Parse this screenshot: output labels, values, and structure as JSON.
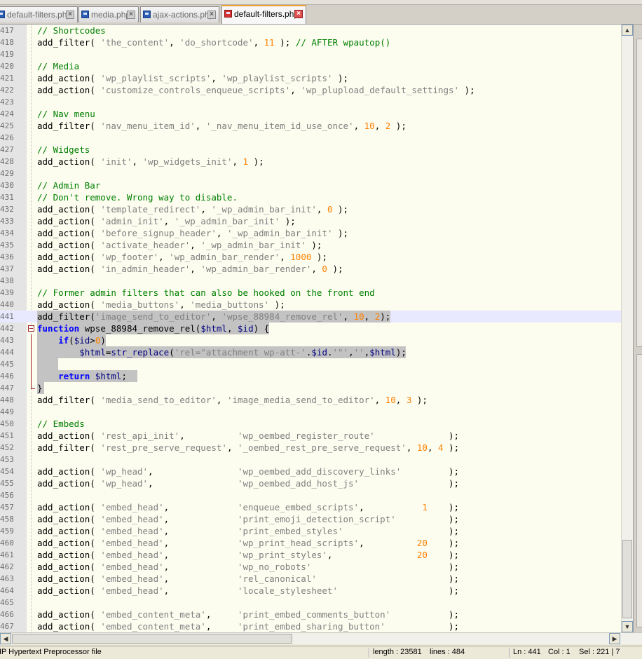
{
  "tabs": [
    {
      "label": "default-filters.php",
      "active": false
    },
    {
      "label": "media.php",
      "active": false
    },
    {
      "label": "ajax-actions.php",
      "active": false
    },
    {
      "label": "default-filters.php",
      "active": true
    }
  ],
  "editor": {
    "current_line": "441",
    "lines": [
      {
        "num": "417",
        "code": [
          {
            "t": "// Shortcodes",
            "c": "c"
          }
        ]
      },
      {
        "num": "418",
        "code": [
          {
            "t": "add_filter( "
          },
          {
            "t": "'the_content'",
            "c": "s"
          },
          {
            "t": ", "
          },
          {
            "t": "'do_shortcode'",
            "c": "s"
          },
          {
            "t": ", "
          },
          {
            "t": "11",
            "c": "n"
          },
          {
            "t": " ); "
          },
          {
            "t": "// AFTER wpautop()",
            "c": "c"
          }
        ]
      },
      {
        "num": "419",
        "code": []
      },
      {
        "num": "420",
        "code": [
          {
            "t": "// Media",
            "c": "c"
          }
        ]
      },
      {
        "num": "421",
        "code": [
          {
            "t": "add_action( "
          },
          {
            "t": "'wp_playlist_scripts'",
            "c": "s"
          },
          {
            "t": ", "
          },
          {
            "t": "'wp_playlist_scripts'",
            "c": "s"
          },
          {
            "t": " );"
          }
        ]
      },
      {
        "num": "422",
        "code": [
          {
            "t": "add_action( "
          },
          {
            "t": "'customize_controls_enqueue_scripts'",
            "c": "s"
          },
          {
            "t": ", "
          },
          {
            "t": "'wp_plupload_default_settings'",
            "c": "s"
          },
          {
            "t": " );"
          }
        ]
      },
      {
        "num": "423",
        "code": []
      },
      {
        "num": "424",
        "code": [
          {
            "t": "// Nav menu",
            "c": "c"
          }
        ]
      },
      {
        "num": "425",
        "code": [
          {
            "t": "add_filter( "
          },
          {
            "t": "'nav_menu_item_id'",
            "c": "s"
          },
          {
            "t": ", "
          },
          {
            "t": "'_nav_menu_item_id_use_once'",
            "c": "s"
          },
          {
            "t": ", "
          },
          {
            "t": "10",
            "c": "n"
          },
          {
            "t": ", "
          },
          {
            "t": "2",
            "c": "n"
          },
          {
            "t": " );"
          }
        ]
      },
      {
        "num": "426",
        "code": []
      },
      {
        "num": "427",
        "code": [
          {
            "t": "// Widgets",
            "c": "c"
          }
        ]
      },
      {
        "num": "428",
        "code": [
          {
            "t": "add_action( "
          },
          {
            "t": "'init'",
            "c": "s"
          },
          {
            "t": ", "
          },
          {
            "t": "'wp_widgets_init'",
            "c": "s"
          },
          {
            "t": ", "
          },
          {
            "t": "1",
            "c": "n"
          },
          {
            "t": " );"
          }
        ]
      },
      {
        "num": "429",
        "code": []
      },
      {
        "num": "430",
        "code": [
          {
            "t": "// Admin Bar",
            "c": "c"
          }
        ]
      },
      {
        "num": "431",
        "code": [
          {
            "t": "// Don't remove. Wrong way to disable.",
            "c": "c"
          }
        ]
      },
      {
        "num": "432",
        "code": [
          {
            "t": "add_action( "
          },
          {
            "t": "'template_redirect'",
            "c": "s"
          },
          {
            "t": ", "
          },
          {
            "t": "'_wp_admin_bar_init'",
            "c": "s"
          },
          {
            "t": ", "
          },
          {
            "t": "0",
            "c": "n"
          },
          {
            "t": " );"
          }
        ]
      },
      {
        "num": "433",
        "code": [
          {
            "t": "add_action( "
          },
          {
            "t": "'admin_init'",
            "c": "s"
          },
          {
            "t": ", "
          },
          {
            "t": "'_wp_admin_bar_init'",
            "c": "s"
          },
          {
            "t": " );"
          }
        ]
      },
      {
        "num": "434",
        "code": [
          {
            "t": "add_action( "
          },
          {
            "t": "'before_signup_header'",
            "c": "s"
          },
          {
            "t": ", "
          },
          {
            "t": "'_wp_admin_bar_init'",
            "c": "s"
          },
          {
            "t": " );"
          }
        ]
      },
      {
        "num": "435",
        "code": [
          {
            "t": "add_action( "
          },
          {
            "t": "'activate_header'",
            "c": "s"
          },
          {
            "t": ", "
          },
          {
            "t": "'_wp_admin_bar_init'",
            "c": "s"
          },
          {
            "t": " );"
          }
        ]
      },
      {
        "num": "436",
        "code": [
          {
            "t": "add_action( "
          },
          {
            "t": "'wp_footer'",
            "c": "s"
          },
          {
            "t": ", "
          },
          {
            "t": "'wp_admin_bar_render'",
            "c": "s"
          },
          {
            "t": ", "
          },
          {
            "t": "1000",
            "c": "n"
          },
          {
            "t": " );"
          }
        ]
      },
      {
        "num": "437",
        "code": [
          {
            "t": "add_action( "
          },
          {
            "t": "'in_admin_header'",
            "c": "s"
          },
          {
            "t": ", "
          },
          {
            "t": "'wp_admin_bar_render'",
            "c": "s"
          },
          {
            "t": ", "
          },
          {
            "t": "0",
            "c": "n"
          },
          {
            "t": " );"
          }
        ]
      },
      {
        "num": "438",
        "code": []
      },
      {
        "num": "439",
        "code": [
          {
            "t": "// Former admin filters that can also be hooked on the front end",
            "c": "c"
          }
        ]
      },
      {
        "num": "440",
        "code": [
          {
            "t": "add_action( "
          },
          {
            "t": "'media_buttons'",
            "c": "s"
          },
          {
            "t": ", "
          },
          {
            "t": "'media_buttons'",
            "c": "s"
          },
          {
            "t": " );"
          }
        ]
      },
      {
        "num": "441",
        "sel": true,
        "code": [
          {
            "t": "add_filter("
          },
          {
            "t": "'image_send_to_editor'",
            "c": "s"
          },
          {
            "t": ", "
          },
          {
            "t": "'wpse_88984_remove_rel'",
            "c": "s"
          },
          {
            "t": ", "
          },
          {
            "t": "10",
            "c": "n"
          },
          {
            "t": ", "
          },
          {
            "t": "2",
            "c": "n"
          },
          {
            "t": ");"
          }
        ]
      },
      {
        "num": "442",
        "sel": true,
        "fold": "start",
        "code": [
          {
            "t": "function",
            "c": "k"
          },
          {
            "t": " wpse_88984_remove_rel("
          },
          {
            "t": "$html",
            "c": "v"
          },
          {
            "t": ", "
          },
          {
            "t": "$id",
            "c": "v"
          },
          {
            "t": ") {"
          }
        ]
      },
      {
        "num": "443",
        "sel": true,
        "fold": "bar",
        "code": [
          {
            "t": "    "
          },
          {
            "t": "if",
            "c": "k"
          },
          {
            "t": "("
          },
          {
            "t": "$id",
            "c": "v"
          },
          {
            "t": ">"
          },
          {
            "t": "0",
            "c": "n"
          },
          {
            "t": ")"
          }
        ]
      },
      {
        "num": "444",
        "sel": true,
        "fold": "bar",
        "code": [
          {
            "t": "        "
          },
          {
            "t": "$html",
            "c": "v"
          },
          {
            "t": "="
          },
          {
            "t": "str_replace",
            "c": "o"
          },
          {
            "t": "("
          },
          {
            "t": "'rel=\"attachment wp-att-'",
            "c": "s"
          },
          {
            "t": "."
          },
          {
            "t": "$id",
            "c": "v"
          },
          {
            "t": "."
          },
          {
            "t": "'\"'",
            "c": "s"
          },
          {
            "t": ","
          },
          {
            "t": "''",
            "c": "s"
          },
          {
            "t": ","
          },
          {
            "t": "$html",
            "c": "v"
          },
          {
            "t": ");"
          }
        ]
      },
      {
        "num": "445",
        "sel": true,
        "fold": "bar",
        "code": [
          {
            "t": "    "
          }
        ]
      },
      {
        "num": "446",
        "sel": true,
        "fold": "bar",
        "code": [
          {
            "t": "    "
          },
          {
            "t": "return",
            "c": "k"
          },
          {
            "t": " "
          },
          {
            "t": "$html",
            "c": "v"
          },
          {
            "t": ";  "
          }
        ]
      },
      {
        "num": "447",
        "sel": true,
        "fold": "end",
        "code": [
          {
            "t": "}"
          }
        ]
      },
      {
        "num": "448",
        "code": [
          {
            "t": "add_filter( "
          },
          {
            "t": "'media_send_to_editor'",
            "c": "s"
          },
          {
            "t": ", "
          },
          {
            "t": "'image_media_send_to_editor'",
            "c": "s"
          },
          {
            "t": ", "
          },
          {
            "t": "10",
            "c": "n"
          },
          {
            "t": ", "
          },
          {
            "t": "3",
            "c": "n"
          },
          {
            "t": " );"
          }
        ]
      },
      {
        "num": "449",
        "code": []
      },
      {
        "num": "450",
        "code": [
          {
            "t": "// Embeds",
            "c": "c"
          }
        ]
      },
      {
        "num": "451",
        "code": [
          {
            "t": "add_action( "
          },
          {
            "t": "'rest_api_init'",
            "c": "s"
          },
          {
            "t": ",          "
          },
          {
            "t": "'wp_oembed_register_route'",
            "c": "s"
          },
          {
            "t": "              );"
          }
        ]
      },
      {
        "num": "452",
        "code": [
          {
            "t": "add_filter( "
          },
          {
            "t": "'rest_pre_serve_request'",
            "c": "s"
          },
          {
            "t": ", "
          },
          {
            "t": "'_oembed_rest_pre_serve_request'",
            "c": "s"
          },
          {
            "t": ", "
          },
          {
            "t": "10",
            "c": "n"
          },
          {
            "t": ", "
          },
          {
            "t": "4",
            "c": "n"
          },
          {
            "t": " );"
          }
        ]
      },
      {
        "num": "453",
        "code": []
      },
      {
        "num": "454",
        "code": [
          {
            "t": "add_action( "
          },
          {
            "t": "'wp_head'",
            "c": "s"
          },
          {
            "t": ",                "
          },
          {
            "t": "'wp_oembed_add_discovery_links'",
            "c": "s"
          },
          {
            "t": "         );"
          }
        ]
      },
      {
        "num": "455",
        "code": [
          {
            "t": "add_action( "
          },
          {
            "t": "'wp_head'",
            "c": "s"
          },
          {
            "t": ",                "
          },
          {
            "t": "'wp_oembed_add_host_js'",
            "c": "s"
          },
          {
            "t": "                 );"
          }
        ]
      },
      {
        "num": "456",
        "code": []
      },
      {
        "num": "457",
        "code": [
          {
            "t": "add_action( "
          },
          {
            "t": "'embed_head'",
            "c": "s"
          },
          {
            "t": ",             "
          },
          {
            "t": "'enqueue_embed_scripts'",
            "c": "s"
          },
          {
            "t": ",           "
          },
          {
            "t": "1",
            "c": "n"
          },
          {
            "t": "    );"
          }
        ]
      },
      {
        "num": "458",
        "code": [
          {
            "t": "add_action( "
          },
          {
            "t": "'embed_head'",
            "c": "s"
          },
          {
            "t": ",             "
          },
          {
            "t": "'print_emoji_detection_script'",
            "c": "s"
          },
          {
            "t": "          );"
          }
        ]
      },
      {
        "num": "459",
        "code": [
          {
            "t": "add_action( "
          },
          {
            "t": "'embed_head'",
            "c": "s"
          },
          {
            "t": ",             "
          },
          {
            "t": "'print_embed_styles'",
            "c": "s"
          },
          {
            "t": "                    );"
          }
        ]
      },
      {
        "num": "460",
        "code": [
          {
            "t": "add_action( "
          },
          {
            "t": "'embed_head'",
            "c": "s"
          },
          {
            "t": ",             "
          },
          {
            "t": "'wp_print_head_scripts'",
            "c": "s"
          },
          {
            "t": ",          "
          },
          {
            "t": "20",
            "c": "n"
          },
          {
            "t": "    );"
          }
        ]
      },
      {
        "num": "461",
        "code": [
          {
            "t": "add_action( "
          },
          {
            "t": "'embed_head'",
            "c": "s"
          },
          {
            "t": ",             "
          },
          {
            "t": "'wp_print_styles'",
            "c": "s"
          },
          {
            "t": ",                "
          },
          {
            "t": "20",
            "c": "n"
          },
          {
            "t": "    );"
          }
        ]
      },
      {
        "num": "462",
        "code": [
          {
            "t": "add_action( "
          },
          {
            "t": "'embed_head'",
            "c": "s"
          },
          {
            "t": ",             "
          },
          {
            "t": "'wp_no_robots'",
            "c": "s"
          },
          {
            "t": "                          );"
          }
        ]
      },
      {
        "num": "463",
        "code": [
          {
            "t": "add_action( "
          },
          {
            "t": "'embed_head'",
            "c": "s"
          },
          {
            "t": ",             "
          },
          {
            "t": "'rel_canonical'",
            "c": "s"
          },
          {
            "t": "                         );"
          }
        ]
      },
      {
        "num": "464",
        "code": [
          {
            "t": "add_action( "
          },
          {
            "t": "'embed_head'",
            "c": "s"
          },
          {
            "t": ",             "
          },
          {
            "t": "'locale_stylesheet'",
            "c": "s"
          },
          {
            "t": "                     );"
          }
        ]
      },
      {
        "num": "465",
        "code": []
      },
      {
        "num": "466",
        "code": [
          {
            "t": "add_action( "
          },
          {
            "t": "'embed_content_meta'",
            "c": "s"
          },
          {
            "t": ",     "
          },
          {
            "t": "'print_embed_comments_button'",
            "c": "s"
          },
          {
            "t": "           );"
          }
        ]
      },
      {
        "num": "467",
        "code": [
          {
            "t": "add_action( "
          },
          {
            "t": "'embed_content_meta'",
            "c": "s"
          },
          {
            "t": ",     "
          },
          {
            "t": "'print_embed_sharing_button'",
            "c": "s"
          },
          {
            "t": "            );"
          }
        ]
      }
    ]
  },
  "statusbar": {
    "file_type": "HP Hypertext Preprocessor file",
    "length": "length : 23581",
    "lines": "lines : 484",
    "ln": "Ln : 441",
    "col": "Col : 1",
    "sel": "Sel : 221 | 7"
  },
  "colors": {
    "comment": "#008000",
    "string": "#808080",
    "number": "#ff8000",
    "keyword": "#0000ff",
    "selection": "#c3c3c3",
    "active_tab_accent": "#f0a030"
  },
  "icons": {
    "tab_file": "php-file-icon",
    "tab_close": "close-icon",
    "fold": "fold-minus-icon"
  }
}
